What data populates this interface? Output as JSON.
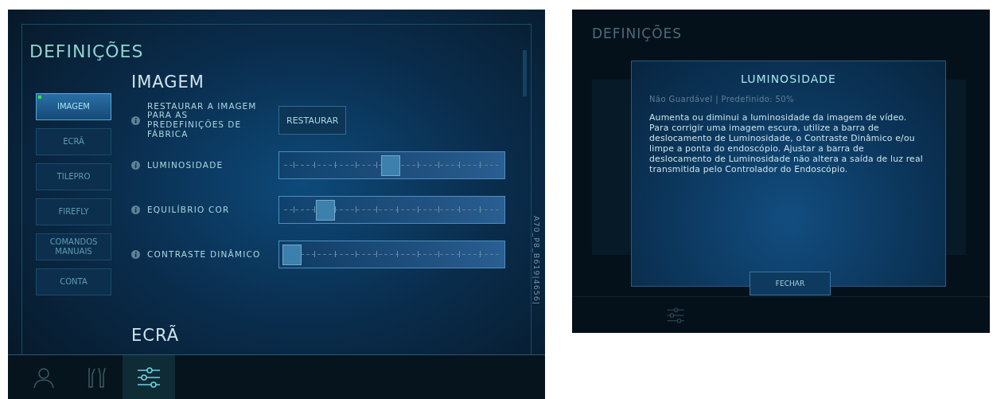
{
  "settings_screen": {
    "title": "DEFINIÇÕES",
    "nav": [
      {
        "label": "IMAGEM",
        "selected": true
      },
      {
        "label": "ECRÃ",
        "selected": false
      },
      {
        "label": "TILEPRO",
        "selected": false
      },
      {
        "label": "FIREFLY",
        "selected": false
      },
      {
        "label": "COMANDOS MANUAIS",
        "selected": false
      },
      {
        "label": "CONTA",
        "selected": false
      }
    ],
    "section": "IMAGEM",
    "settings": [
      {
        "kind": "button",
        "label": "RESTAURAR A IMAGEM PARA AS PREDEFINIÇÕES DE FÁBRICA",
        "button": "RESTAURAR"
      },
      {
        "kind": "slider",
        "label": "LUMINOSIDADE",
        "level": 0.5
      },
      {
        "kind": "slider",
        "label": "EQUILÍBRIO COR",
        "level": 0.17
      },
      {
        "kind": "slider",
        "label": "CONTRASTE DINÂMICO",
        "level": 0
      }
    ],
    "next_section": "ECRÃ",
    "side_code": "A70_P8_B619|4656|",
    "bottom_tabs": [
      {
        "kind": "user",
        "selected": false
      },
      {
        "kind": "instruments",
        "selected": false
      },
      {
        "kind": "settings",
        "selected": true
      }
    ]
  },
  "info_screen": {
    "background_title": "DEFINIÇÕES",
    "dialog": {
      "title": "LUMINOSIDADE",
      "subtitle": "Não Guardável | Predefinido: 50%",
      "body": "Aumenta ou diminui a luminosidade da imagem de vídeo. Para corrigir uma imagem escura, utilize a barra de deslocamento de Luminosidade, o Contraste Dinâmico e/ou limpe a ponta do endoscópio. Ajustar a barra de deslocamento de Luminosidade não altera a saída de luz real transmitida pelo Controlador do Endoscópio.",
      "button": "FECHAR"
    }
  }
}
